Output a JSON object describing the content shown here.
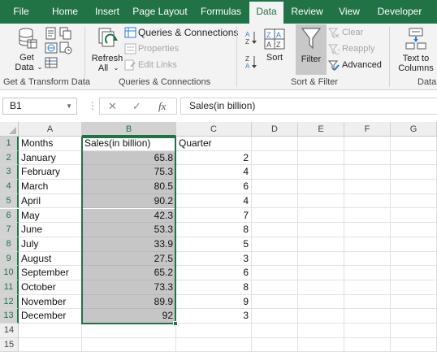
{
  "tabs": [
    "File",
    "Home",
    "Insert",
    "Page Layout",
    "Formulas",
    "Data",
    "Review",
    "View",
    "Developer"
  ],
  "ribbon": {
    "get_data": {
      "label": "Get",
      "label2": "Data"
    },
    "group_get_transform": "Get & Transform Data",
    "queries_connections": "Queries & Connections",
    "properties": "Properties",
    "edit_links": "Edit Links",
    "refresh": {
      "label": "Refresh",
      "label2": "All"
    },
    "group_queries": "Queries & Connections",
    "sort": "Sort",
    "filter": "Filter",
    "clear": "Clear",
    "reapply": "Reapply",
    "advanced": "Advanced",
    "group_sort_filter": "Sort & Filter",
    "text_to_columns": {
      "label": "Text to",
      "label2": "Columns"
    },
    "group_data": "Data"
  },
  "formula_bar": {
    "name_box": "B1",
    "cancel": "✕",
    "enter": "✓",
    "fx": "fx",
    "formula": "Sales(in billion)"
  },
  "sheet": {
    "columns": [
      "A",
      "B",
      "C",
      "D",
      "E",
      "F",
      "G"
    ],
    "rows": [
      "1",
      "2",
      "3",
      "4",
      "5",
      "6",
      "7",
      "8",
      "9",
      "10",
      "11",
      "12",
      "13",
      "14",
      "15"
    ],
    "header_row": [
      "Months",
      "Sales(in billion)",
      "Quarter"
    ],
    "data": [
      [
        "January",
        "65.8",
        "2"
      ],
      [
        "February",
        "75.3",
        "4"
      ],
      [
        "March",
        "80.5",
        "6"
      ],
      [
        "April",
        "90.2",
        "4"
      ],
      [
        "May",
        "42.3",
        "7"
      ],
      [
        "June",
        "53.3",
        "8"
      ],
      [
        "July",
        "33.9",
        "5"
      ],
      [
        "August",
        "27.5",
        "3"
      ],
      [
        "September",
        "65.2",
        "6"
      ],
      [
        "October",
        "73.3",
        "8"
      ],
      [
        "November",
        "89.9",
        "9"
      ],
      [
        "December",
        "92",
        "3"
      ]
    ]
  },
  "colors": {
    "accent": "#217346",
    "selection": "#c6c6c6"
  }
}
